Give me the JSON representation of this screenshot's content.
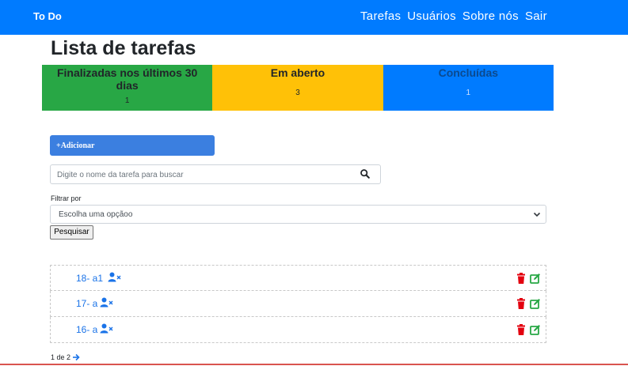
{
  "navbar": {
    "brand": "To Do",
    "links": [
      "Tarefas",
      "Usuários",
      "Sobre nós",
      "Sair"
    ]
  },
  "page_title": "Lista de tarefas",
  "cards": [
    {
      "title": "Finalizadas nos últimos 30 dias",
      "count": "1",
      "color": "#28a745"
    },
    {
      "title": "Em aberto",
      "count": "3",
      "color": "#ffc107"
    },
    {
      "title": "Concluídas",
      "count": "1",
      "color": "#007bff"
    }
  ],
  "add_button": {
    "label": "Adicionar",
    "icon": "plus-icon"
  },
  "search": {
    "placeholder": "Digite o nome da tarefa para buscar",
    "icon": "search-icon"
  },
  "filter": {
    "label": "Filtrar por",
    "selected": "Escolha uma opçãoo"
  },
  "search_button": "Pesquisar",
  "tasks": [
    {
      "name": "18- a1"
    },
    {
      "name": "17- a"
    },
    {
      "name": "16- a"
    }
  ],
  "pagination": {
    "text": "1 de 2"
  },
  "colors": {
    "primary": "#007bff",
    "danger": "#e3000f",
    "success": "#28a745"
  }
}
